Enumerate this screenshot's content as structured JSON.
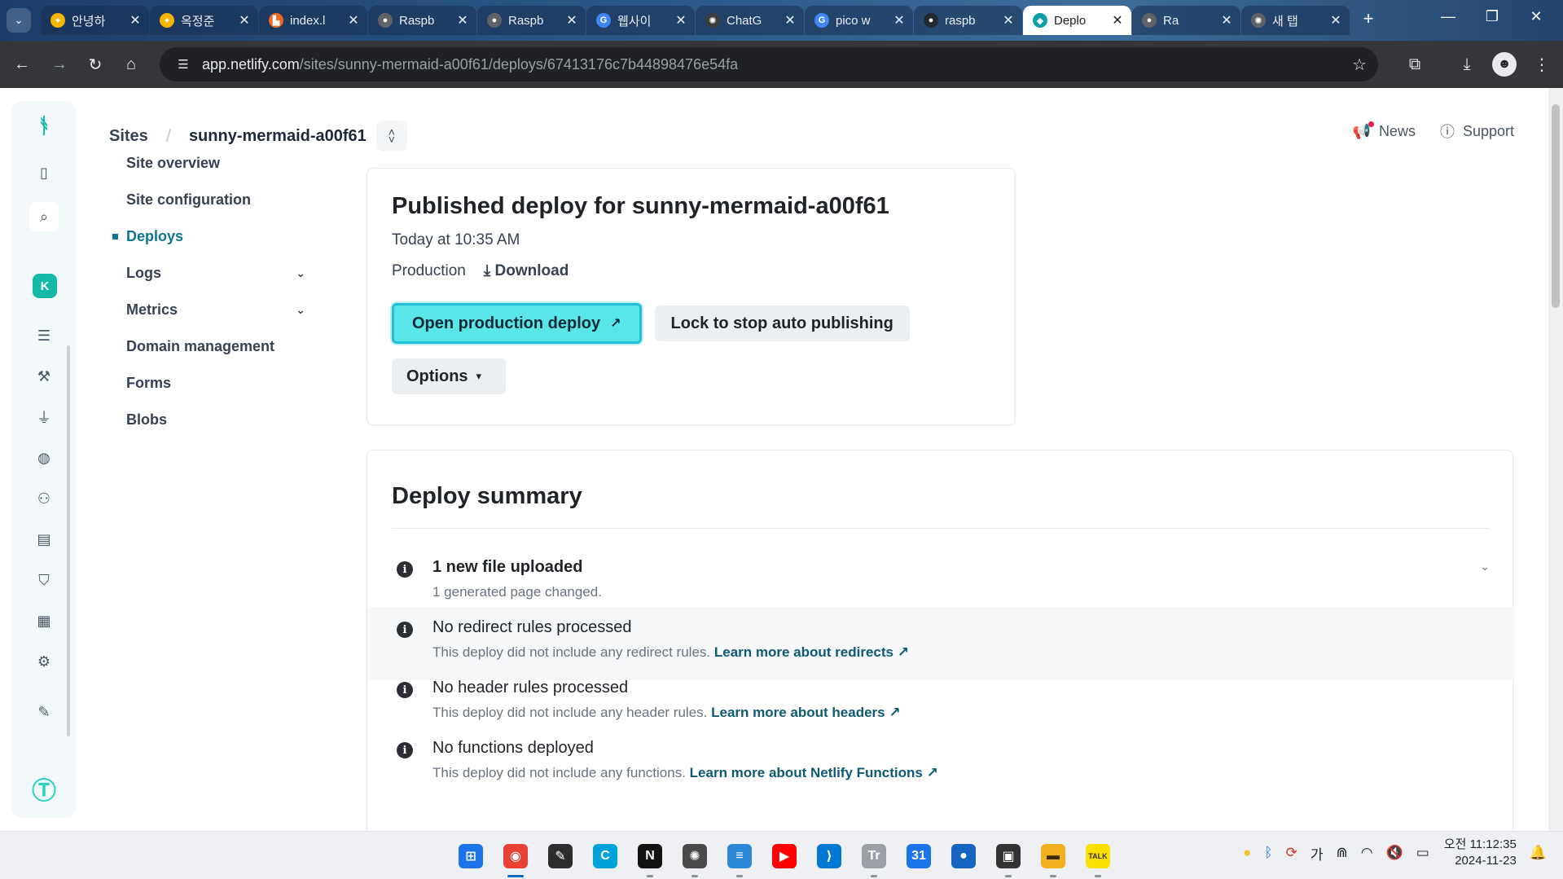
{
  "browser": {
    "tabs": [
      {
        "title": "안녕하",
        "color": "#f4b400",
        "icon": "sparkle-icon",
        "glyph": "✦"
      },
      {
        "title": "옥정준",
        "color": "#f4b400",
        "icon": "sparkle-icon",
        "glyph": "✦"
      },
      {
        "title": "index.l",
        "color": "#f26622",
        "icon": "file-icon",
        "glyph": "▙"
      },
      {
        "title": "Raspb",
        "color": "#5f6368",
        "icon": "raspberry-icon",
        "glyph": "●"
      },
      {
        "title": "Raspb",
        "color": "#5f6368",
        "icon": "raspberry-icon",
        "glyph": "●"
      },
      {
        "title": "웹사이",
        "color": "#4285f4",
        "icon": "google-icon",
        "glyph": "G"
      },
      {
        "title": "ChatG",
        "color": "#3c3c3c",
        "icon": "openai-icon",
        "glyph": "✺"
      },
      {
        "title": "pico w",
        "color": "#4285f4",
        "icon": "google-icon",
        "glyph": "G"
      },
      {
        "title": "raspb",
        "color": "#24292f",
        "icon": "github-icon",
        "glyph": "●"
      },
      {
        "title": "Deplo",
        "color": "#0e9fa8",
        "icon": "netlify-icon",
        "glyph": "◆",
        "active": true
      },
      {
        "title": "Ra",
        "color": "#5f6368",
        "icon": "raspberry-icon",
        "glyph": "●"
      },
      {
        "title": "새 탭",
        "color": "#5f6368",
        "icon": "openai-icon",
        "glyph": "✺"
      }
    ],
    "new_tab_glyph": "+",
    "url_host": "app.netlify.com",
    "url_path": "/sites/sunny-mermaid-a00f61/deploys/67413176c7b44898476e54fa"
  },
  "breadcrumb": {
    "sites": "Sites",
    "separator": "/",
    "site_name": "sunny-mermaid-a00f61"
  },
  "topright": {
    "news": "News",
    "support": "Support"
  },
  "subnav": [
    {
      "label": "Site overview",
      "name": "subnav-site-overview"
    },
    {
      "label": "Site configuration",
      "name": "subnav-site-configuration"
    },
    {
      "label": "Deploys",
      "name": "subnav-deploys",
      "active": true
    },
    {
      "label": "Logs",
      "name": "subnav-logs",
      "chevron": true
    },
    {
      "label": "Metrics",
      "name": "subnav-metrics",
      "chevron": true
    },
    {
      "label": "Domain management",
      "name": "subnav-domain-management"
    },
    {
      "label": "Forms",
      "name": "subnav-forms"
    },
    {
      "label": "Blobs",
      "name": "subnav-blobs"
    }
  ],
  "publish_card": {
    "title": "Published deploy for sunny-mermaid-a00f61",
    "time": "Today at 10:35 AM",
    "context": "Production",
    "download": "Download",
    "open_button": "Open production deploy",
    "lock_button": "Lock to stop auto publishing",
    "options_button": "Options"
  },
  "summary": {
    "title": "Deploy summary",
    "rows": [
      {
        "heading": "1 new file uploaded",
        "bold": true,
        "desc": "1 generated page changed.",
        "link": "",
        "expandable": true,
        "shaded": false
      },
      {
        "heading": "No redirect rules processed",
        "bold": false,
        "desc": "This deploy did not include any redirect rules.",
        "link": "Learn more about redirects",
        "expandable": false,
        "shaded": true
      },
      {
        "heading": "No header rules processed",
        "bold": false,
        "desc": "This deploy did not include any header rules.",
        "link": "Learn more about headers",
        "expandable": false,
        "shaded": false
      },
      {
        "heading": "No functions deployed",
        "bold": false,
        "desc": "This deploy did not include any functions.",
        "link": "Learn more about Netlify Functions",
        "expandable": false,
        "shaded": false
      }
    ]
  },
  "taskbar": {
    "apps": [
      {
        "name": "start-button",
        "icon": "windows-icon",
        "glyph": "⊞",
        "bg": "#1a73e8",
        "running": false
      },
      {
        "name": "taskbar-chrome",
        "icon": "chrome-icon",
        "glyph": "◉",
        "bg": "#e94235",
        "running": true,
        "current": true
      },
      {
        "name": "taskbar-app-3",
        "icon": "paint-icon",
        "glyph": "✎",
        "bg": "#2d2d2d",
        "running": false
      },
      {
        "name": "taskbar-app-4",
        "icon": "canva-icon",
        "glyph": "C",
        "bg": "#00a3d9",
        "running": false
      },
      {
        "name": "taskbar-notion",
        "icon": "notion-icon",
        "glyph": "N",
        "bg": "#111111",
        "running": true
      },
      {
        "name": "taskbar-chatgpt",
        "icon": "openai-icon",
        "glyph": "✺",
        "bg": "#4a4a4a",
        "running": true
      },
      {
        "name": "taskbar-notepad",
        "icon": "notepad-icon",
        "glyph": "≡",
        "bg": "#2b88d8",
        "running": true
      },
      {
        "name": "taskbar-youtube",
        "icon": "youtube-icon",
        "glyph": "▶",
        "bg": "#ff0000",
        "running": false
      },
      {
        "name": "taskbar-vscode",
        "icon": "vscode-icon",
        "glyph": "⟩",
        "bg": "#0078d4",
        "running": false
      },
      {
        "name": "taskbar-app-10",
        "icon": "text-icon",
        "glyph": "Tr",
        "bg": "#9aa0a6",
        "running": true
      },
      {
        "name": "taskbar-calendar",
        "icon": "calendar-icon",
        "glyph": "31",
        "bg": "#1a73e8",
        "running": false
      },
      {
        "name": "taskbar-app-12",
        "icon": "circle-app-icon",
        "glyph": "●",
        "bg": "#1565c0",
        "running": false
      },
      {
        "name": "taskbar-app-13",
        "icon": "terminal-icon",
        "glyph": "▣",
        "bg": "#333333",
        "running": true
      },
      {
        "name": "taskbar-explorer",
        "icon": "folder-icon",
        "glyph": "▬",
        "bg": "#f2b01e",
        "running": true
      },
      {
        "name": "taskbar-kakaotalk",
        "icon": "kakaotalk-icon",
        "glyph": "TALK",
        "bg": "#f9e000",
        "running": true
      }
    ],
    "clock_time": "오전 11:12:35",
    "clock_date": "2024-11-23"
  }
}
